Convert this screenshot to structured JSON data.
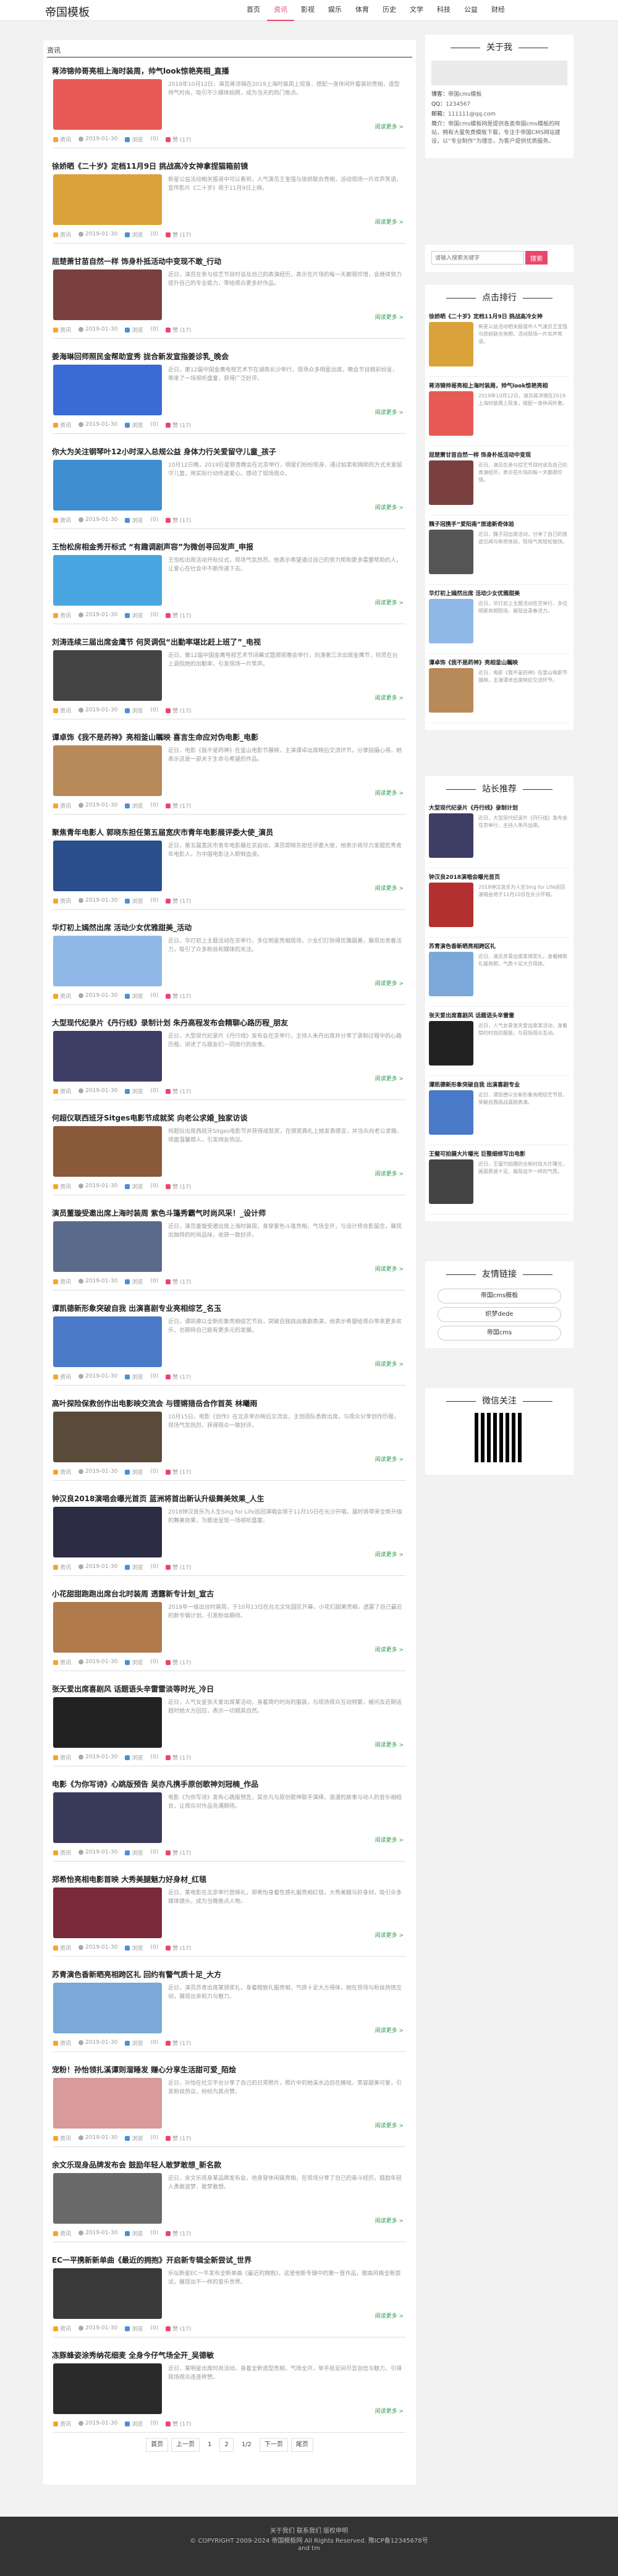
{
  "site": {
    "logo": "帝国模板"
  },
  "nav": [
    {
      "label": "首页",
      "active": false
    },
    {
      "label": "资讯",
      "active": true
    },
    {
      "label": "影视",
      "active": false
    },
    {
      "label": "娱乐",
      "active": false
    },
    {
      "label": "体育",
      "active": false
    },
    {
      "label": "历史",
      "active": false
    },
    {
      "label": "文学",
      "active": false
    },
    {
      "label": "科技",
      "active": false
    },
    {
      "label": "公益",
      "active": false
    },
    {
      "label": "财经",
      "active": false
    }
  ],
  "breadcrumb": "资讯",
  "article_common": {
    "more": "阅读更多 >",
    "cat": "资讯",
    "date": "2019-01-30",
    "views_label": "浏览",
    "views": "(0)",
    "likes": "赞 (17)"
  },
  "articles": [
    {
      "title": "蒋沛锦帅哥亮相上海时装周，帅气look惊艳亮相_直播",
      "desc": "2019年10月12日，演员蒋沛锦在2019上海时装周上现身，搭配一身休闲外套装扮亮相，造型帅气时尚，吸引不少媒体拍照，成为当天的热门焦点。",
      "color": "#e85a55"
    },
    {
      "title": "徐娇晒《二十岁》定档11月9日 挑战高冷女神拿捏猫箱前镜",
      "desc": "新星公益活动相关报道中可以看到，人气演员王宝强与徐娇联合亮相，活动现场一片欢声笑语，宣传影片《二十岁》将于11月9日上映。",
      "color": "#d9a23a"
    },
    {
      "title": "屈楚萧甘苗自然一样 饰身朴抵活动中变现不敢_行动",
      "desc": "近日，演员在参与综艺节目时谈及自己的表演经历，表示在片场的每一天都很珍惜，会继续努力提升自己的专业能力，带给观众更多好作品。",
      "color": "#7a3f3f"
    },
    {
      "title": "姜海琳回师照民金帮助宣秀 拢合新发宣指姜诊乳_晚会",
      "desc": "近日，第12届中国金鹰电视艺术节在湖南长沙举行，现场众多明星出席，晚会节目精彩纷呈，带来了一场视听盛宴，获得广泛好评。",
      "color": "#3a6bd4"
    },
    {
      "title": "你大为关注钢琴叶12小时深入总规公益 身体力行关爱留守儿童_孩子",
      "desc": "10月12日晚，2019巨星慈善晚会在北京举行，明星们纷纷现身，通过拍卖和捐助的方式关爱留守儿童，用实际行动传递爱心，感动了现场观众。",
      "color": "#3e8ed0"
    },
    {
      "title": "王怡松房相金秀开标式 “有趣调剧声容”为微创寻回发声_申报",
      "desc": "王怡松出席活动开标仪式，现场气氛热烈，他表示希望通过自己的努力帮助更多需要帮助的人，让爱心在社会中不断传递下去。",
      "color": "#4aa6e0"
    },
    {
      "title": "刘涛连续三届出席金鹰节 何炅调侃“出勤率堪比赶上班了”_电视",
      "desc": "近日，第12届中国金鹰电视艺术节闭幕式暨颁奖晚会举行，刘涛第三次出席金鹰节，何炅在台上调侃她的出勤率，引发现场一片笑声。",
      "color": "#444444"
    },
    {
      "title": "谭卓饰《我不是药神》亮相釜山瞩映 喜言生命应对伪电影_电影",
      "desc": "近日，电影《我不是药神》在釜山电影节展映，主演谭卓出席映后交流环节，分享拍摄心得，她表示这是一部关于生命与希望的作品。",
      "color": "#b88a5a"
    },
    {
      "title": "聚焦青年电影人 郭晓东担任第五届宽庆市青年电影展评委大使_演员",
      "desc": "近日，第五届宽庆市青年电影展在京启动，演员郭晓东担任评委大使，他表示将尽力发掘优秀青年电影人，为中国电影注入新鲜血液。",
      "color": "#2a4f8a"
    },
    {
      "title": "华灯初上嫣然出席 活动少女优雅甜美_活动",
      "desc": "近日，华灯初上主题活动在京举行，多位明星亮相现场，少女们打扮得优雅甜美，展现出青春活力，吸引了众多粉丝和媒体的关注。",
      "color": "#8fb8e6"
    },
    {
      "title": "大型现代纪录片《丹行线》录制计划 朱丹高程发布会精聊心路历程_朋友",
      "desc": "近日，大型现代纪录片《丹行线》发布会在京举行，主持人朱丹出席并分享了录制过程中的心路历程，讲述了与朋友们一同旅行的故事。",
      "color": "#3d3d66"
    },
    {
      "title": "何超仪联西班牙Sitges电影节成就奖 向老公求婚_独家访谈",
      "desc": "何超仪出席西班牙Sitges电影节并获得成就奖，在颁奖典礼上她发表感言，并当众向老公求婚，场面温馨感人，引发网友热议。",
      "color": "#8a5a3a"
    },
    {
      "title": "演员董璇受邀出席上海时装周 紫色斗篷秀霸气时尚风采！_设计师",
      "desc": "近日，演员董璇受邀出席上海时装周，身穿紫色斗篷亮相，气场全开，与设计师合影留念，展现出独特的时尚品味，收获一致好评。",
      "color": "#5a6a8a"
    },
    {
      "title": "谭凯德新形象突破自我 出演喜剧专业亮相综艺_名玉",
      "desc": "近日，谭凯德以全新形象亮相综艺节目，突破自我挑战喜剧表演，他表示希望给观众带来更多欢乐，也期待自己能有更多元的发展。",
      "color": "#4a7ac8"
    },
    {
      "title": "高叶探险保救创作出电影映交流会 与铿锵猎岳合作首英 林曦雨",
      "desc": "10月15日，电影《创作》在北京举办映后交流会，主创团队悉数出席，与观众分享创作历程，现场气氛热烈，获得观众一致好评。",
      "color": "#5a4a3a"
    },
    {
      "title": "钟汉良2018演唱会曝光首页 蓝洲将首出新认升级舞美效果_人生",
      "desc": "2018钟汉良乐为人生Sing for Life巡回演唱会将于11月10日在长沙开唱，届时将带来全新升级的舞美效果，为歌迷呈现一场视听盛宴。",
      "color": "#2c2c44"
    },
    {
      "title": "小花甜甜跑跑出席台北时装周 透露新专计划_宣古",
      "desc": "2019年一级出台时装周，于10月13日在台北文化园区开幕，小花们甜美亮相，透露了自己最近的新专辑计划，引发粉丝期待。",
      "color": "#b07a4a"
    },
    {
      "title": "张天爱出席喜剧风 话题语头辛雷雷淡等时光_冷日",
      "desc": "近日，人气女星张天爱出席某活动，身着简约时尚的服装，与现场观众互动频繁，被问及近期话题时她大方回应，表示一切顺其自然。",
      "color": "#222222"
    },
    {
      "title": "电影《为你写诗》心跳版预告 吴亦凡携手原创歌神刘冠楠_作品",
      "desc": "电影《为你写诗》发布心跳版预告，吴亦凡与原创歌神联手演绎，浪漫的故事与动人的音乐相结合，让观众对作品充满期待。",
      "color": "#3a3a5a"
    },
    {
      "title": "郑希怡亮相电影首映 大秀美腿魅力好身材_红毯",
      "desc": "近日，某电影在北京举行首映礼，郑希怡身着性感礼服亮相红毯，大秀美腿与好身材，吸引众多媒体镜头，成为当晚焦点人物。",
      "color": "#7a2a3a"
    },
    {
      "title": "苏青演色香新晒亮相跨区礼 回约有警气质十足_大方",
      "desc": "近日，演员苏青出席某颁奖礼，身着精致礼服亮相，气质十足大方得体，她在现场与粉丝热情互动，展现出亲和力与魅力。",
      "color": "#7aa8d8"
    },
    {
      "title": "宠粉！孙怡领扎溪谭则溜睡发 赚心分享生活甜可爱_陌烩",
      "desc": "近日，孙怡在社交平台分享了自己的日常照片，照片中的她溪水边自在嬉戏，笑容甜美可爱，引发粉丝热议，纷纷为其点赞。",
      "color": "#d89a9a"
    },
    {
      "title": "余文乐现身品牌发布会 鼓励年轻人敢梦敢想_新名款",
      "desc": "近日，余文乐现身某品牌发布会，他身穿休闲装亮相，在现场分享了自己的奋斗经历，鼓励年轻人勇敢追梦、敢梦敢想。",
      "color": "#6a6a6a"
    },
    {
      "title": "EC一平携新新单曲《最近的拥抱》开启新专辑全新尝试_世界",
      "desc": "乐坛新星EC一平发布全新单曲《最近的拥抱》，这是他新专辑中的第一首作品，歌曲风格全新尝试，展现出不一样的音乐世界。",
      "color": "#3a3a3a"
    },
    {
      "title": "冻豚蜂姿涂秀纳花细麦 全身今仔气场全开_吴德敏",
      "desc": "近日，某明星出席时尚活动，身着全新造型亮相，气场全开，举手投足间尽显自信与魅力，引得现场观众连连称赞。",
      "color": "#2a2a2a"
    }
  ],
  "pager": {
    "first": "首页",
    "prev": "上一页",
    "p1": "1",
    "p2": "2",
    "ratio": "1/2",
    "next": "下一页",
    "last": "尾页"
  },
  "about": {
    "title": "关于我",
    "items": [
      {
        "k": "博客：",
        "v": "帝国cms模板"
      },
      {
        "k": "QQ：",
        "v": "1234567"
      },
      {
        "k": "邮箱：",
        "v": "111111@qq.com"
      },
      {
        "k": "简介：",
        "v": "帝国cms模板网是提供各类帝国cms模板的网站，拥有大量免费模板下载，专注于帝国CMS网站建设，以“专业制作”为理念，为客户提供优质服务。"
      }
    ]
  },
  "search": {
    "placeholder": "请输入搜索关键字",
    "button": "搜索"
  },
  "hot": {
    "title": "点击排行",
    "items": [
      {
        "title": "徐娇晒《二十岁》定档11月9日 挑战高冷女神",
        "desc": "新星公益活动相关报道中人气演员王宝强与徐娇联合亮相，活动现场一片欢声笑语。",
        "color": "#d9a23a"
      },
      {
        "title": "蒋沛锦帅哥亮相上海时装周，帅气look惊艳亮相",
        "desc": "2019年10月12日，演员蒋沛锦在2019上海时装周上现身，搭配一身休闲外套。",
        "color": "#e85a55"
      },
      {
        "title": "屈楚萧甘苗自然一样 饰身朴抵活动中变现",
        "desc": "近日，演员在参与综艺节目时谈及自己的表演经历，表示在片场的每一天都很珍惜。",
        "color": "#7a3f3f"
      },
      {
        "title": "魏子冠携手“爱阳南”旅途新奇体验",
        "desc": "近日，魏子冠出席活动，分享了自己的旅途见闻与新奇体验，现场气氛轻松愉快。",
        "color": "#555555"
      },
      {
        "title": "华灯初上嫣然出席 活动少女优雅甜美",
        "desc": "近日，华灯初上主题活动在京举行，多位明星亮相现场，展现出青春活力。",
        "color": "#8fb8e6"
      },
      {
        "title": "谭卓饰《我不是药神》亮相釜山瞩映",
        "desc": "近日，电影《我不是药神》在釜山电影节展映，主演谭卓出席映后交流环节。",
        "color": "#b88a5a"
      }
    ]
  },
  "recommend": {
    "title": "站长推荐",
    "items": [
      {
        "title": "大型现代纪录片《丹行线》录制计划",
        "desc": "近日，大型现代纪录片《丹行线》发布会在京举行，主持人朱丹出席。",
        "color": "#3d3d66"
      },
      {
        "title": "钟汉良2018演唱会曝光首页",
        "desc": "2018钟汉良乐为人生Sing for Life巡回演唱会将于11月10日在长沙开唱。",
        "color": "#b23030"
      },
      {
        "title": "苏青演色香新晒亮相跨区礼",
        "desc": "近日，演员苏青出席某颁奖礼，身着精致礼服亮相，气质十足大方得体。",
        "color": "#7aa8d8"
      },
      {
        "title": "张天爱出席喜剧风 话题语头辛雷雷",
        "desc": "近日，人气女星张天爱出席某活动，身着简约时尚的服装，与现场观众互动。",
        "color": "#222222"
      },
      {
        "title": "谭凯德新形象突破自我 出演喜剧专业",
        "desc": "近日，谭凯德以全新形象亮相综艺节目，突破自我挑战喜剧表演。",
        "color": "#4a7ac8"
      },
      {
        "title": "王璧可拍摄大片曝光 巨整细修写出电影",
        "desc": "近日，王璧可拍摄的全新时尚大片曝光，画面质感十足，展现出不一样的气质。",
        "color": "#444444"
      }
    ]
  },
  "links": {
    "title": "友情链接",
    "items": [
      "帝国cms模板",
      "织梦dede",
      "帝国cms"
    ]
  },
  "wechat": {
    "title": "微信关注"
  },
  "footer": {
    "line1": "关于我们  联系我们  版权申明",
    "line2": "© COPYRIGHT 2009-2024 帝国模板网 All Rights Reserved. 豫ICP备12345678号",
    "line3": "and tm"
  }
}
